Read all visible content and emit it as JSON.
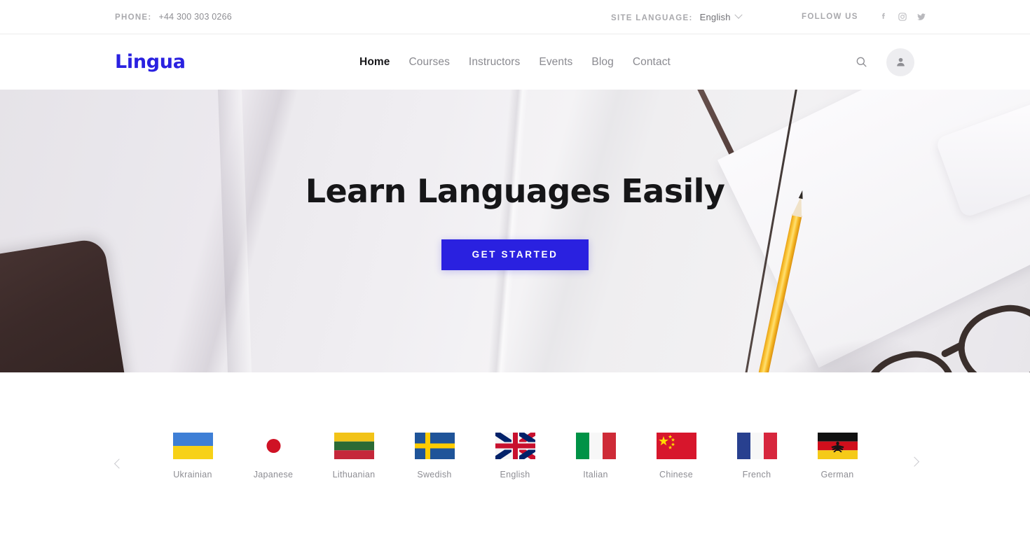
{
  "topbar": {
    "phone_label": "PHONE:",
    "phone_value": "+44 300 303 0266",
    "site_language_label": "SITE LANGUAGE:",
    "site_language_value": "English",
    "follow_us_label": "FOLLOW US",
    "social": [
      {
        "name": "facebook",
        "title": "Facebook"
      },
      {
        "name": "instagram",
        "title": "Instagram"
      },
      {
        "name": "twitter",
        "title": "Twitter"
      }
    ]
  },
  "header": {
    "logo": "Lingua",
    "nav": [
      {
        "label": "Home",
        "active": true
      },
      {
        "label": "Courses",
        "active": false
      },
      {
        "label": "Instructors",
        "active": false
      },
      {
        "label": "Events",
        "active": false
      },
      {
        "label": "Blog",
        "active": false
      },
      {
        "label": "Contact",
        "active": false
      }
    ],
    "search_icon": "search-icon",
    "account_icon": "user-icon"
  },
  "hero": {
    "title": "Learn Languages Easily",
    "cta_label": "GET STARTED",
    "cta_color": "#2a21e0"
  },
  "languages": {
    "prev_icon": "chevron-left-icon",
    "next_icon": "chevron-right-icon",
    "items": [
      {
        "label": "Ukrainian",
        "flag": "ukraine"
      },
      {
        "label": "Japanese",
        "flag": "japan"
      },
      {
        "label": "Lithuanian",
        "flag": "lithuania"
      },
      {
        "label": "Swedish",
        "flag": "sweden"
      },
      {
        "label": "English",
        "flag": "uk"
      },
      {
        "label": "Italian",
        "flag": "italy"
      },
      {
        "label": "Chinese",
        "flag": "china"
      },
      {
        "label": "French",
        "flag": "france"
      },
      {
        "label": "German",
        "flag": "germany"
      }
    ]
  },
  "colors": {
    "brand": "#2a21e0",
    "text_muted": "#8d8d93",
    "text_dark": "#161618"
  }
}
